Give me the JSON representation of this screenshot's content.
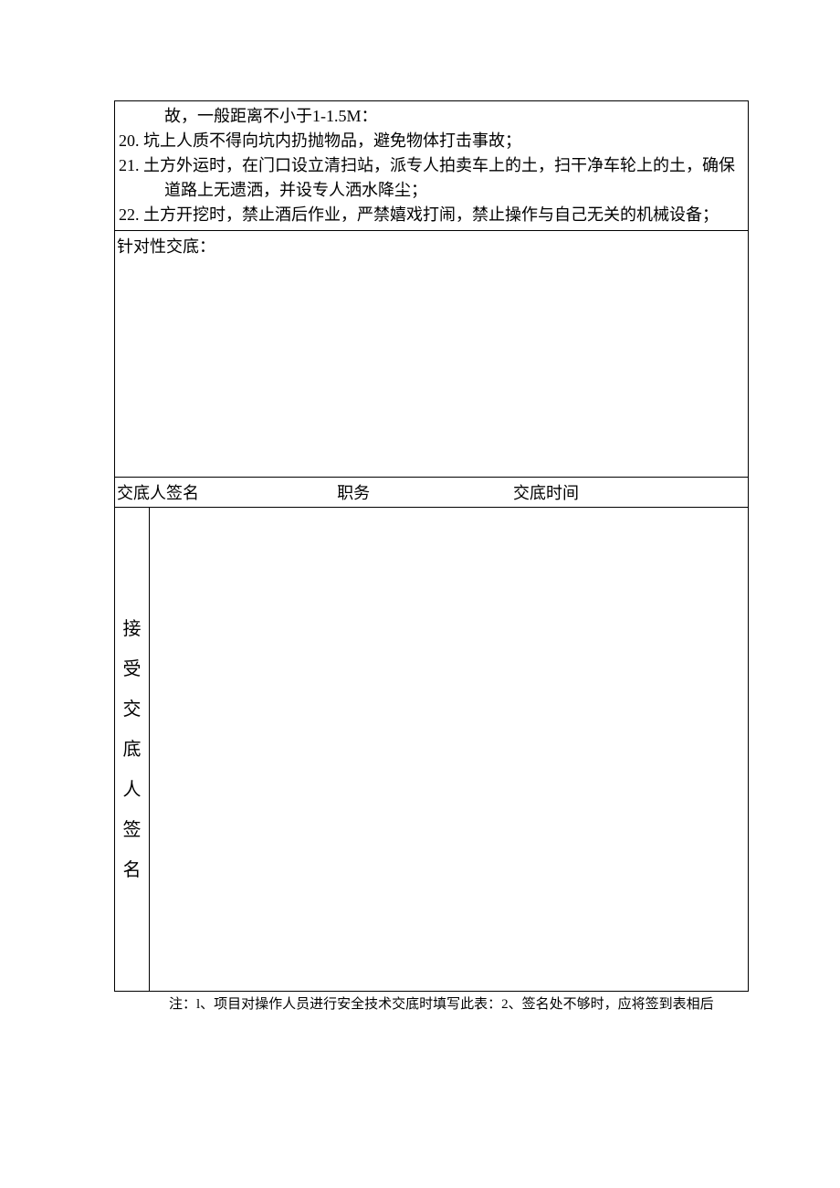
{
  "items_block": {
    "continuation_line": "故，一般距离不小于1-1.5M：",
    "items": [
      {
        "num": "20.",
        "text": "坑上人质不得向坑内扔抛物品，避免物体打击事故；"
      },
      {
        "num": "21.",
        "text": "土方外运时，在门口设立清扫站，派专人拍卖车上的土，扫干净车轮上的土，确保道路上无遗洒，并设专人洒水降尘；"
      },
      {
        "num": "22.",
        "text": "土方开挖时，禁止酒后作业，严禁嬉戏打闹，禁止操作与自己无关的机械设备；"
      }
    ]
  },
  "targeted": {
    "label": "针对性交底："
  },
  "sign_row": {
    "signer_label": "交底人签名",
    "position_label": "职务",
    "time_label": "交底时间"
  },
  "receiver": {
    "label_chars": [
      "接",
      "受",
      "交",
      "底",
      "人",
      "签",
      "名"
    ]
  },
  "footnote": "注：l、项目对操作人员进行安全技术交底时填写此表：2、签名处不够时，应将签到表相后"
}
